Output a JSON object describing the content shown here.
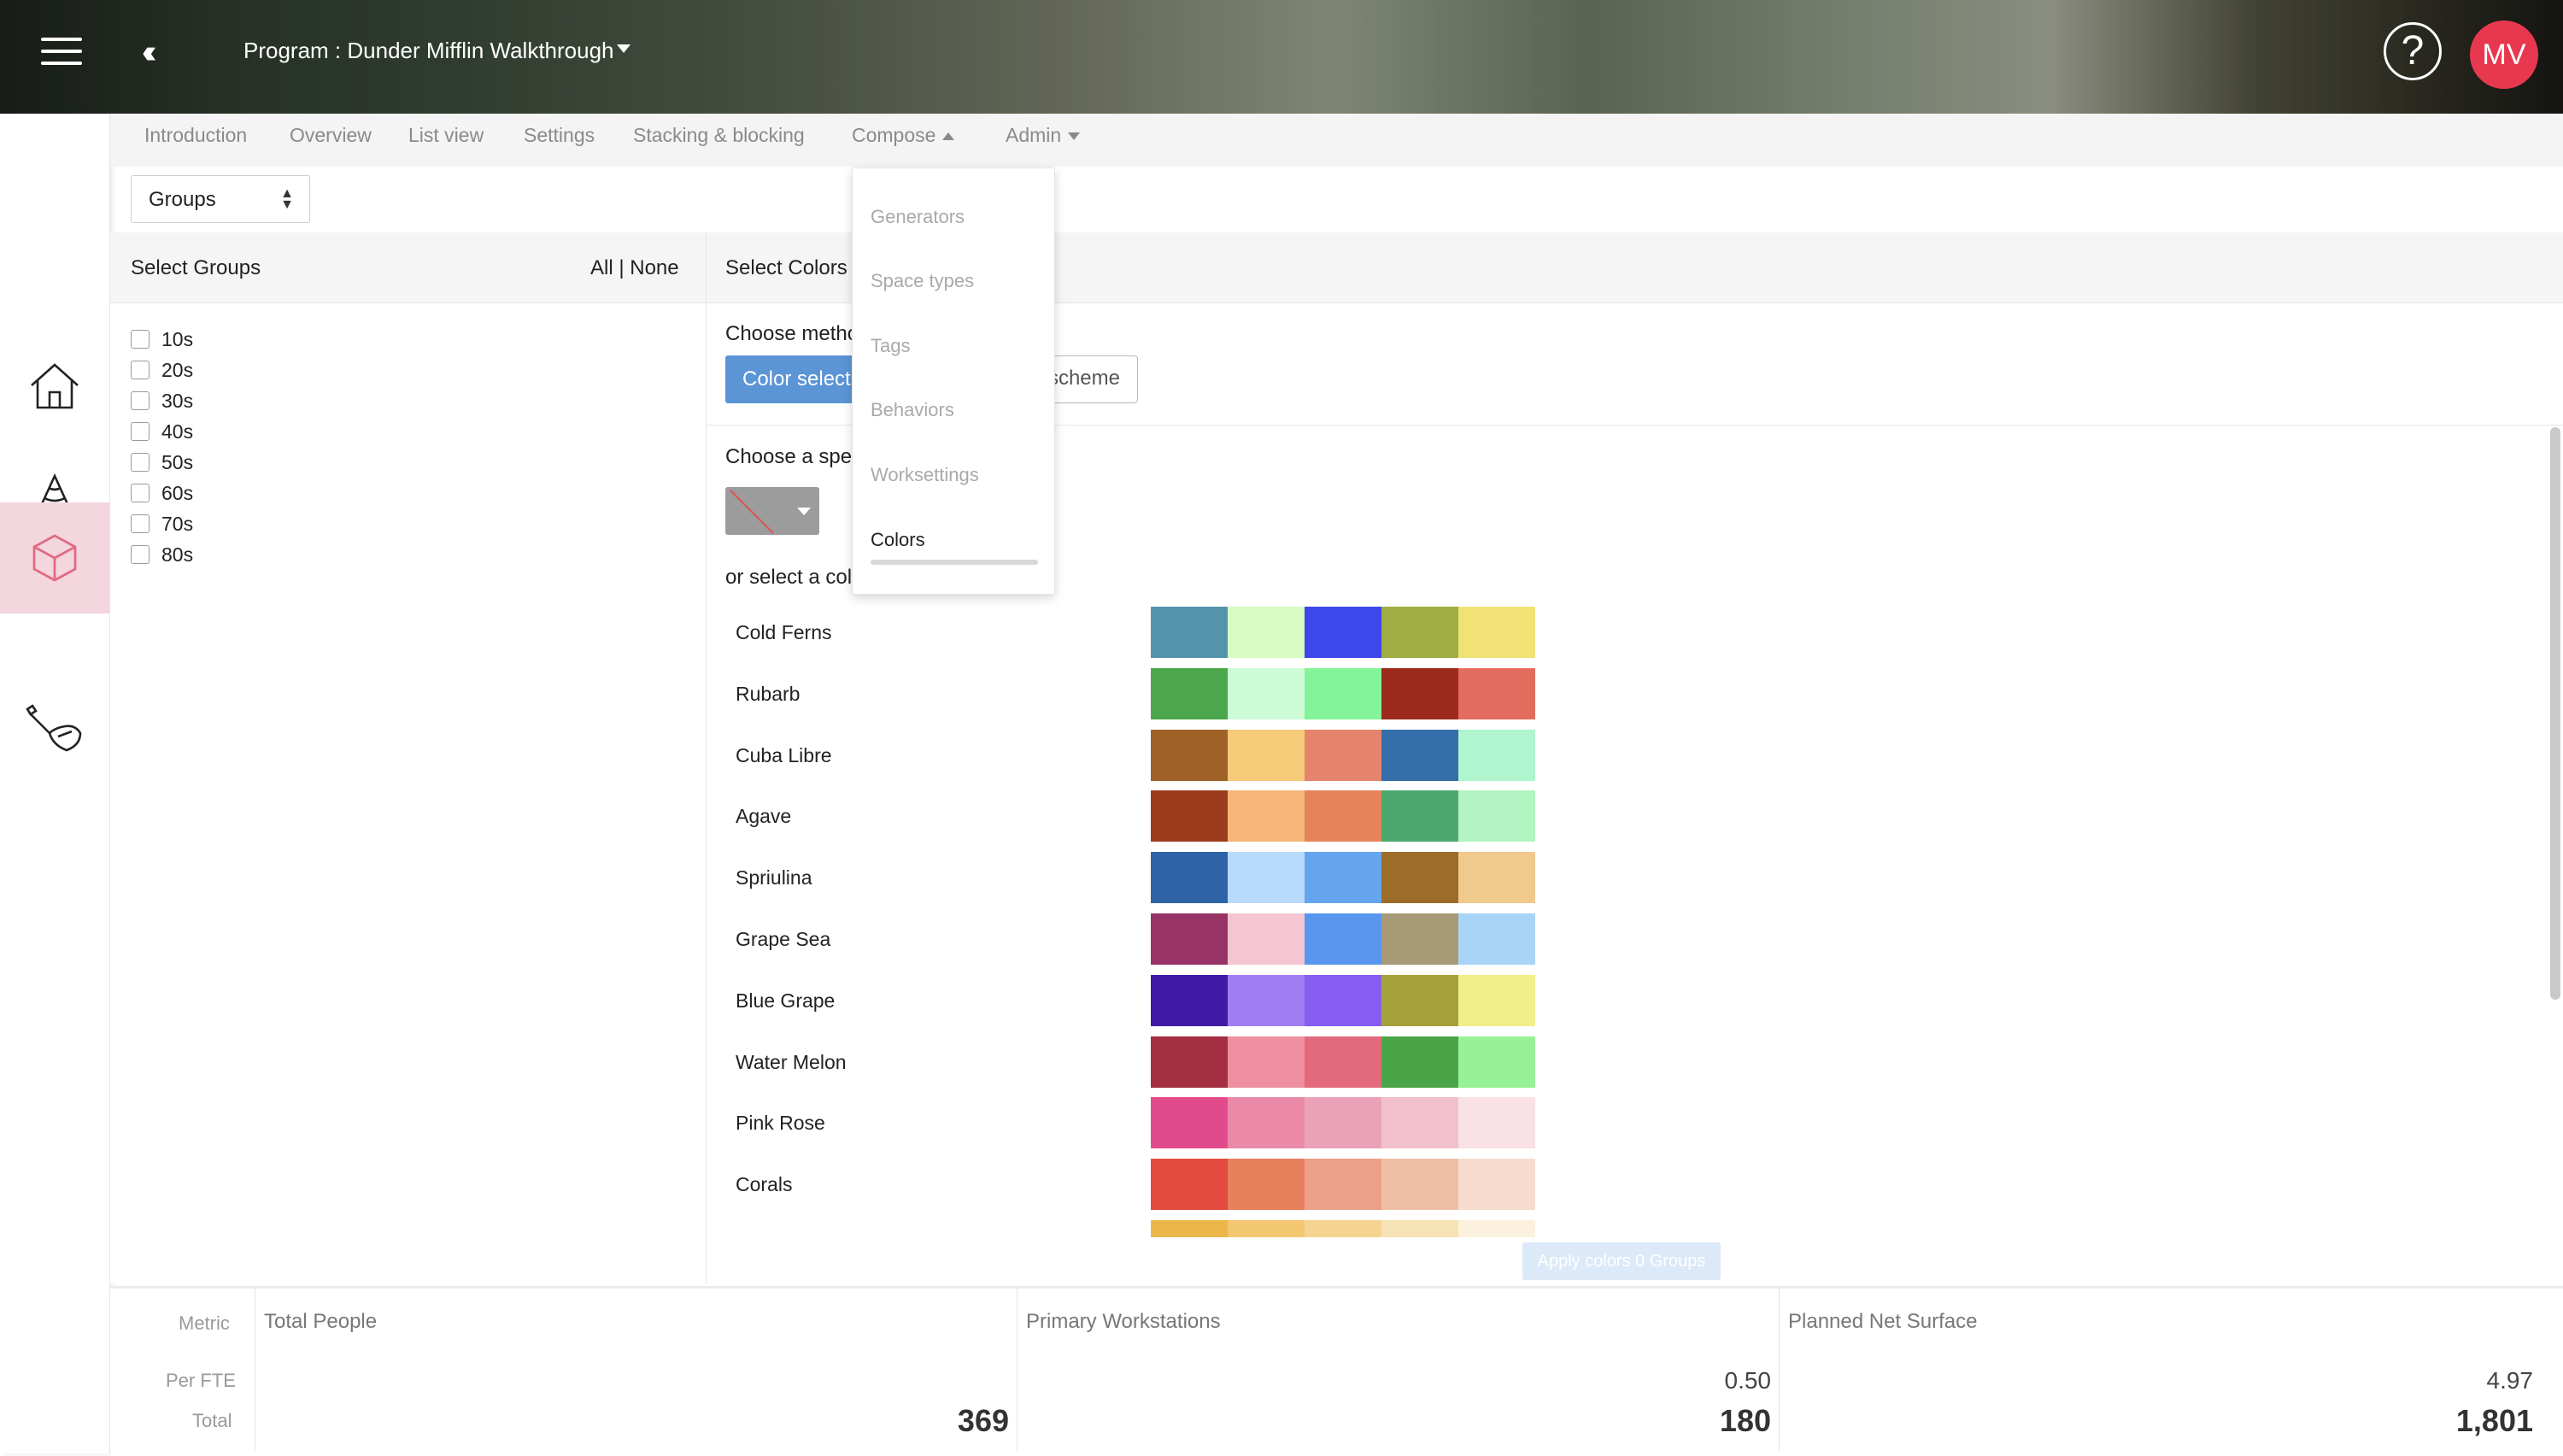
{
  "header": {
    "program_title": "Program : Dunder Mifflin Walkthrough",
    "help_glyph": "?",
    "avatar_initials": "MV",
    "avatar_color": "#e8384f"
  },
  "rail": {
    "items": [
      {
        "icon": "home-icon"
      },
      {
        "icon": "cone-icon"
      },
      {
        "icon": "cube-icon",
        "active": true
      },
      {
        "icon": "brush-icon"
      }
    ],
    "active_bg": "#f3d6de",
    "active_color": "#e16b84"
  },
  "tabs": {
    "items": [
      "Introduction",
      "Overview",
      "List view",
      "Settings",
      "Stacking & blocking",
      "Compose",
      "Admin"
    ]
  },
  "groups_select": {
    "value": "Groups"
  },
  "left_panel": {
    "title": "Select Groups",
    "all_none": "All | None",
    "groups": [
      "10s",
      "20s",
      "30s",
      "40s",
      "50s",
      "60s",
      "70s",
      "80s"
    ]
  },
  "right_panel": {
    "title": "Select Colors",
    "choose_method": "Choose metho",
    "color_select_btn": "Color select",
    "scheme_btn": "scheme",
    "choose_specific": "Choose a spec",
    "or_select": "or select a col",
    "palettes": [
      {
        "name": "Cold Ferns",
        "colors": [
          "#5593ad",
          "#d6fbc3",
          "#3d47eb",
          "#a1ae43",
          "#f1e276"
        ]
      },
      {
        "name": "Rubarb",
        "colors": [
          "#4ba64c",
          "#cdfbd6",
          "#83f49a",
          "#9b2a1c",
          "#e26c5e"
        ]
      },
      {
        "name": "Cuba Libre",
        "colors": [
          "#a06126",
          "#f6ca78",
          "#e5846d",
          "#356eab",
          "#b0f5ce"
        ]
      },
      {
        "name": "Agave",
        "colors": [
          "#9b3c1d",
          "#f5b678",
          "#e7835b",
          "#4da86f",
          "#b2f3c2"
        ]
      },
      {
        "name": "Spriulina",
        "colors": [
          "#2f63a7",
          "#b8dafc",
          "#64a5ee",
          "#9e6c29",
          "#f0c98d"
        ]
      },
      {
        "name": "Grape Sea",
        "colors": [
          "#983465",
          "#f4c6d2",
          "#5996ee",
          "#a89a77",
          "#a8d4f7"
        ]
      },
      {
        "name": "Blue Grape",
        "colors": [
          "#3f1ba5",
          "#a17df3",
          "#865df0",
          "#a7a13b",
          "#f2ee8b"
        ]
      },
      {
        "name": "Water Melon",
        "colors": [
          "#a32f41",
          "#ef8f9f",
          "#e36a7c",
          "#4aa548",
          "#97f197"
        ]
      },
      {
        "name": "Pink Rose",
        "colors": [
          "#e24b8b",
          "#ea8aa8",
          "#eaa2b8",
          "#f2bfcc",
          "#f9e1e6"
        ]
      },
      {
        "name": "Corals",
        "colors": [
          "#e14b40",
          "#e7805d",
          "#eca088",
          "#f0bea6",
          "#f7dccd"
        ]
      },
      {
        "name": "",
        "colors": [
          "#ecb74a",
          "#f3c76f",
          "#f5d492",
          "#f7e2b6",
          "#fbf1dd"
        ]
      }
    ],
    "apply_btn": "Apply colors 0 Groups"
  },
  "compose_dropdown": {
    "items": [
      "Generators",
      "Space types",
      "Tags",
      "Behaviors",
      "Worksettings",
      "Colors"
    ],
    "active": "Colors"
  },
  "metrics": {
    "row_labels": {
      "metric": "Metric",
      "per_fte": "Per FTE",
      "total": "Total"
    },
    "columns": [
      {
        "header": "Total People",
        "per_fte": "",
        "total": "369"
      },
      {
        "header": "Primary Workstations",
        "per_fte": "0.50",
        "total": "180"
      },
      {
        "header": "Planned Net Surface",
        "per_fte": "4.97",
        "total": "1,801"
      }
    ]
  }
}
